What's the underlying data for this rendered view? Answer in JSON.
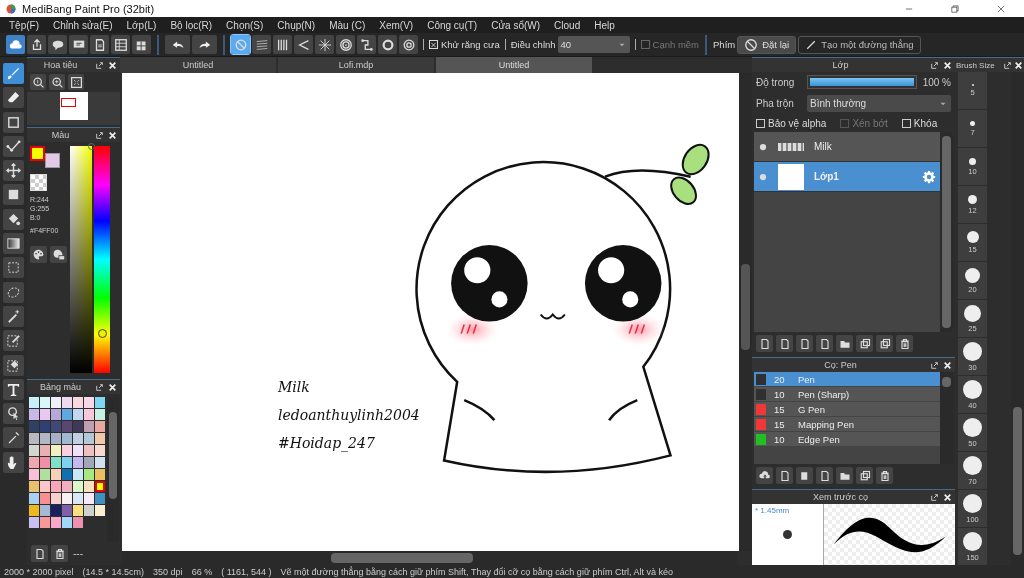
{
  "window": {
    "title": "MediBang Paint Pro (32bit)"
  },
  "menu": [
    "Tệp(F)",
    "Chỉnh sửa(E)",
    "Lớp(L)",
    "Bộ lọc(R)",
    "Chọn(S)",
    "Chụp(N)",
    "Màu (C)",
    "Xem(V)",
    "Công cụ(T)",
    "Cửa sổ(W)",
    "Cloud",
    "Help"
  ],
  "toolbar": {
    "rulers": [
      {
        "selected": true
      },
      {
        "selected": false
      },
      {
        "selected": false
      },
      {
        "selected": false
      },
      {
        "selected": false
      },
      {
        "selected": false
      },
      {
        "selected": false
      },
      {
        "selected": false
      },
      {
        "selected": false
      }
    ],
    "antialias": {
      "label": "Khử răng cưa",
      "checked": true
    },
    "correction": {
      "label": "Điều chỉnh",
      "value": "40"
    },
    "soft_edge": {
      "label": "Cạnh mềm",
      "checked": false
    },
    "keys_label": "Phím",
    "reset_button": "Đặt lại",
    "line_button": "Tạo một đường thẳng"
  },
  "tools": [
    {
      "selected": true
    },
    {
      "selected": false
    },
    {
      "selected": false
    },
    {
      "selected": false
    },
    {
      "selected": false
    },
    {
      "selected": false
    },
    {
      "selected": false
    },
    {
      "selected": false
    },
    {
      "selected": false
    },
    {
      "selected": false
    },
    {
      "selected": false
    },
    {
      "selected": false
    },
    {
      "selected": false
    },
    {
      "selected": false
    },
    {
      "selected": false
    },
    {
      "selected": false
    },
    {
      "selected": false
    }
  ],
  "navigator": {
    "title": "Hoa tiêu"
  },
  "color_panel": {
    "title": "Màu",
    "foreground": {
      "color": "#f4ff00"
    },
    "background": {
      "color": "#e3c8ea"
    },
    "r": "R:244",
    "g": "G:255",
    "b": "B:0",
    "hex": "#F4FF00",
    "hue": {
      "level": 0.17
    }
  },
  "palette": {
    "title": "Bảng màu",
    "footer": "---",
    "swatches": [
      {
        "color": "#c8f0f8",
        "selected": false
      },
      {
        "color": "#d8f8f8",
        "selected": false
      },
      {
        "color": "#f0f0fa",
        "selected": false
      },
      {
        "color": "#f0d8f0",
        "selected": false
      },
      {
        "color": "#f8d8e0",
        "selected": false
      },
      {
        "color": "#f8d8e8",
        "selected": false
      },
      {
        "color": "#80d8f0",
        "selected": false
      },
      {
        "color": "#c8b8e8",
        "selected": false
      },
      {
        "color": "#e8c8f0",
        "selected": false
      },
      {
        "color": "#b8a8d8",
        "selected": false
      },
      {
        "color": "#60a8e0",
        "selected": false
      },
      {
        "color": "#c0d8f0",
        "selected": false
      },
      {
        "color": "#f8c8d8",
        "selected": false
      },
      {
        "color": "#c8f0e0",
        "selected": false
      },
      {
        "color": "#304060",
        "selected": false
      },
      {
        "color": "#304070",
        "selected": false
      },
      {
        "color": "#404878",
        "selected": false
      },
      {
        "color": "#584870",
        "selected": false
      },
      {
        "color": "#403858",
        "selected": false
      },
      {
        "color": "#c0a0b0",
        "selected": false
      },
      {
        "color": "#e8a8a0",
        "selected": false
      },
      {
        "color": "#b8b8c0",
        "selected": false
      },
      {
        "color": "#b0b8c8",
        "selected": false
      },
      {
        "color": "#a8b0c8",
        "selected": false
      },
      {
        "color": "#a0b8d0",
        "selected": false
      },
      {
        "color": "#c0d0e0",
        "selected": false
      },
      {
        "color": "#b0c8d8",
        "selected": false
      },
      {
        "color": "#f0c8a8",
        "selected": false
      },
      {
        "color": "#d0d8d0",
        "selected": false
      },
      {
        "color": "#e8b0b0",
        "selected": false
      },
      {
        "color": "#f0f0c0",
        "selected": false
      },
      {
        "color": "#f8d0e0",
        "selected": false
      },
      {
        "color": "#f0e0f8",
        "selected": false
      },
      {
        "color": "#f0c0c0",
        "selected": false
      },
      {
        "color": "#f8d8d0",
        "selected": false
      },
      {
        "color": "#f0a8b0",
        "selected": false
      },
      {
        "color": "#f090a8",
        "selected": false
      },
      {
        "color": "#80e0c8",
        "selected": false
      },
      {
        "color": "#80d0f0",
        "selected": false
      },
      {
        "color": "#c8b8f0",
        "selected": false
      },
      {
        "color": "#a0a8b8",
        "selected": false
      },
      {
        "color": "#d0e0f0",
        "selected": false
      },
      {
        "color": "#f8c0d8",
        "selected": false
      },
      {
        "color": "#b0e0a0",
        "selected": false
      },
      {
        "color": "#f8d0b8",
        "selected": false
      },
      {
        "color": "#1070b0",
        "selected": false
      },
      {
        "color": "#c8e8f8",
        "selected": false
      },
      {
        "color": "#a8e880",
        "selected": false
      },
      {
        "color": "#e8c060",
        "selected": false
      },
      {
        "color": "#e8c070",
        "selected": false
      },
      {
        "color": "#f8c8c8",
        "selected": false
      },
      {
        "color": "#f8a8b8",
        "selected": false
      },
      {
        "color": "#f0b0c0",
        "selected": false
      },
      {
        "color": "#d8f8c8",
        "selected": false
      },
      {
        "color": "#f8e0c0",
        "selected": false
      },
      {
        "color": "#f4ff00",
        "selected": true
      },
      {
        "color": "#a8d0f0",
        "selected": false
      },
      {
        "color": "#f89090",
        "selected": false
      },
      {
        "color": "#f8d0d0",
        "selected": false
      },
      {
        "color": "#f8f0f0",
        "selected": false
      },
      {
        "color": "#d8e8f8",
        "selected": false
      },
      {
        "color": "#f8e8f8",
        "selected": false
      },
      {
        "color": "#4090c0",
        "selected": false
      },
      {
        "color": "#f0b820",
        "selected": false
      },
      {
        "color": "#a8b8d8",
        "selected": false
      },
      {
        "color": "#182060",
        "selected": false
      },
      {
        "color": "#8060a8",
        "selected": false
      },
      {
        "color": "#f8e080",
        "selected": false
      },
      {
        "color": "#d0d0d0",
        "selected": false
      },
      {
        "color": "#f8f0d0",
        "selected": false
      },
      {
        "color": "#c8c0f0",
        "selected": false
      },
      {
        "color": "#f89898",
        "selected": false
      },
      {
        "color": "#f8a8c8",
        "selected": false
      },
      {
        "color": "#a0d8f8",
        "selected": false
      },
      {
        "color": "#f090b0",
        "selected": false
      }
    ]
  },
  "tabs": [
    {
      "label": "Untitled",
      "selected": false
    },
    {
      "label": "Lofi.mdp",
      "selected": false
    },
    {
      "label": "Untitled",
      "selected": true
    }
  ],
  "canvas": {
    "texts": [
      "Milk",
      "ledoanthuylinh2004",
      "#Hoidap_247"
    ]
  },
  "layers_panel": {
    "title": "Lớp",
    "opacity_label": "Độ trong",
    "opacity": {
      "level": 1
    },
    "opacity_value": "100 %",
    "blend_label": "Pha trộn",
    "blend_value": "Bình thường",
    "options": [
      {
        "label": "Bảo vệ alpha",
        "checked": false,
        "disabled": false
      },
      {
        "label": "Xén bớt",
        "checked": false,
        "disabled": true
      },
      {
        "label": "Khóa",
        "checked": false,
        "disabled": false
      }
    ],
    "layers": [
      {
        "name": "Milk",
        "selected": false
      },
      {
        "name": "Lớp1",
        "selected": true
      }
    ]
  },
  "brush_panel": {
    "title": "Cọ: Pen",
    "brushes": [
      {
        "size": "20",
        "name": "Pen",
        "color": "#303030",
        "selected": true
      },
      {
        "size": "10",
        "name": "Pen (Sharp)",
        "color": "#303030",
        "selected": false
      },
      {
        "size": "15",
        "name": "G Pen",
        "color": "#f03838",
        "selected": false
      },
      {
        "size": "15",
        "name": "Mapping Pen",
        "color": "#f03838",
        "selected": false
      },
      {
        "size": "10",
        "name": "Edge Pen",
        "color": "#20c020",
        "selected": false
      }
    ]
  },
  "brush_preview": {
    "title": "Xem trước cọ",
    "size": "* 1.45mm"
  },
  "brush_size": {
    "title": "Brush Size",
    "sizes": [
      "5",
      "7",
      "10",
      "12",
      "15",
      "20",
      "25",
      "30",
      "40",
      "50",
      "70",
      "100",
      "150"
    ]
  },
  "status_bar": [
    "2000 * 2000 pixel",
    "(14.5 * 14.5cm)",
    "350 dpi",
    "66 %",
    "( 1161, 544 )",
    "Vẽ một đường thẳng bằng cách giữ phím Shift, Thay đổi cỡ cọ bằng cách giữ phím Ctrl, Alt và kéo"
  ]
}
